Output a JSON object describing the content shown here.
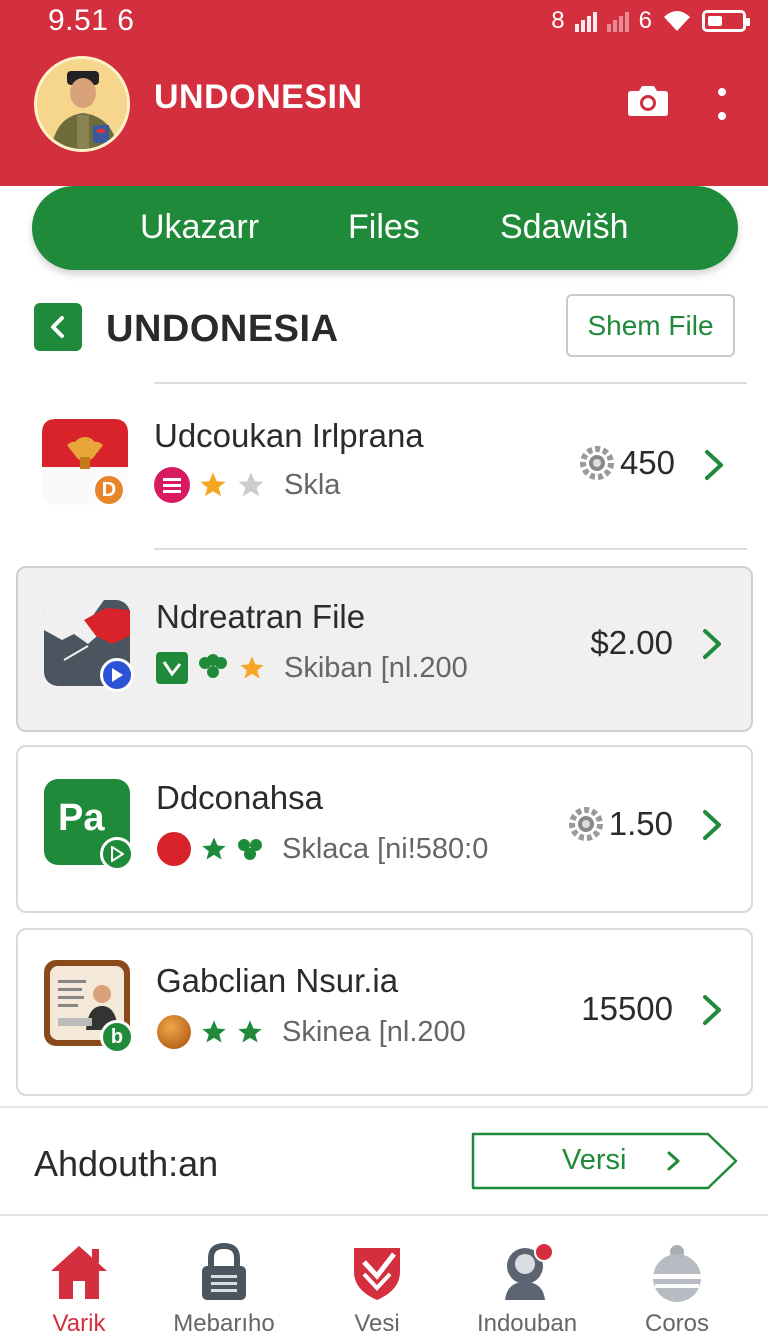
{
  "status_bar": {
    "time": "9.51 6",
    "signal_text": "8",
    "network_text": "6"
  },
  "header": {
    "title": "UNDONESIN"
  },
  "tabs": [
    {
      "label": "Ukazarr"
    },
    {
      "label": "Files"
    },
    {
      "label": "Sdawišh"
    }
  ],
  "section": {
    "title": "UNDONESIA",
    "action_label": "Shem File"
  },
  "items": [
    {
      "title": "Udcoukan Irlprana",
      "meta": "Skla",
      "price": "450",
      "price_icon": "gear-icon",
      "icon": "indonesia-emblem-icon",
      "badge": "D",
      "badge_color": "#e8852a",
      "stars": [
        "#f5a623",
        "#cccccc"
      ],
      "tag_color": "#d81b60"
    },
    {
      "title": "Ndreatran File",
      "meta": "Skiban [nl.200",
      "price": "$2.00",
      "icon": "map-icon",
      "badge_color": "#2d52d6",
      "selected": true
    },
    {
      "title": "Ddconahsa",
      "meta": "Sklaca [ni!580:0",
      "price": "1.50",
      "price_icon": "gear-icon",
      "icon": "pa-app-icon",
      "icon_text": "Pa",
      "badge_color": "#1f8a3a"
    },
    {
      "title": "Gabclian Nsur.ia",
      "meta": "Skinea [nl.200",
      "price": "15500",
      "icon": "presenter-icon",
      "badge": "b",
      "badge_color": "#1f8a3a"
    }
  ],
  "footer_row": {
    "label": "Ahdouth:an",
    "button_label": "Versi"
  },
  "bottom_nav": [
    {
      "label": "Varik",
      "icon": "home-icon",
      "active": true
    },
    {
      "label": "Mebarıho",
      "icon": "lock-icon"
    },
    {
      "label": "Vesi",
      "icon": "shield-icon"
    },
    {
      "label": "Indouban",
      "icon": "user-icon"
    },
    {
      "label": "Coros",
      "icon": "bell-icon"
    }
  ],
  "colors": {
    "header_red": "#d32f3f",
    "brand_green": "#1f8a3a"
  }
}
